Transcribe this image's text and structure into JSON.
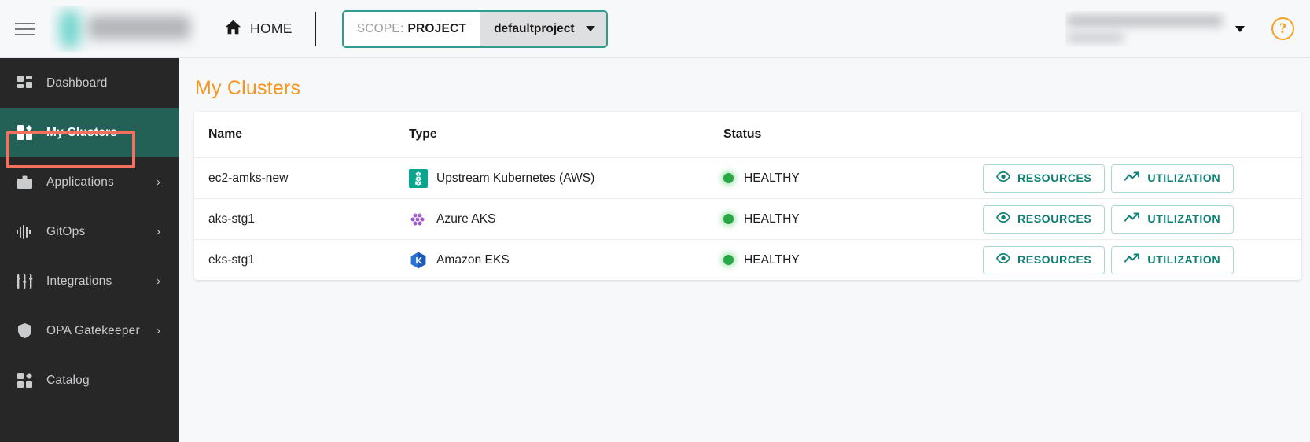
{
  "header": {
    "menu_icon": "hamburger-menu-icon",
    "logo": "",
    "home_label": "HOME",
    "home_icon": "home-icon",
    "scope_key": "SCOPE:",
    "scope_value": "PROJECT",
    "project_name": "defaultproject",
    "user_caret_icon": "chevron-down-icon",
    "help_label": "?",
    "help_icon": "help-question-icon"
  },
  "sidebar": {
    "items": [
      {
        "label": "Dashboard",
        "icon": "dashboard-grid-icon",
        "active": false,
        "chevron": ""
      },
      {
        "label": "My Clusters",
        "icon": "clusters-grid-icon",
        "active": true,
        "chevron": ""
      },
      {
        "label": "Applications",
        "icon": "briefcase-icon",
        "active": false,
        "chevron": "›"
      },
      {
        "label": "GitOps",
        "icon": "waveform-icon",
        "active": false,
        "chevron": "›"
      },
      {
        "label": "Integrations",
        "icon": "sliders-icon",
        "active": false,
        "chevron": "›"
      },
      {
        "label": "OPA Gatekeeper",
        "icon": "shield-icon",
        "active": false,
        "chevron": "›"
      },
      {
        "label": "Catalog",
        "icon": "catalog-grid-icon",
        "active": false,
        "chevron": ""
      }
    ]
  },
  "main": {
    "page_title": "My Clusters",
    "table": {
      "columns": [
        "Name",
        "Type",
        "Status"
      ],
      "rows": [
        {
          "name": "ec2-amks-new",
          "type": "Upstream Kubernetes (AWS)",
          "type_icon": "upstream-kubernetes-aws-icon",
          "status": "HEALTHY",
          "status_color": "#27a844",
          "resources_label": "RESOURCES",
          "utilization_label": "UTILIZATION"
        },
        {
          "name": "aks-stg1",
          "type": "Azure AKS",
          "type_icon": "azure-aks-icon",
          "status": "HEALTHY",
          "status_color": "#27a844",
          "resources_label": "RESOURCES",
          "utilization_label": "UTILIZATION"
        },
        {
          "name": "eks-stg1",
          "type": "Amazon EKS",
          "type_icon": "amazon-eks-icon",
          "status": "HEALTHY",
          "status_color": "#27a844",
          "resources_label": "RESOURCES",
          "utilization_label": "UTILIZATION"
        }
      ]
    }
  },
  "annotation": {
    "highlight_color": "#f4705e",
    "target": "My Clusters"
  },
  "colors": {
    "accent_orange": "#f7941e",
    "active_teal": "#236156",
    "button_teal": "#0f8074",
    "sidebar_bg": "#272727"
  }
}
